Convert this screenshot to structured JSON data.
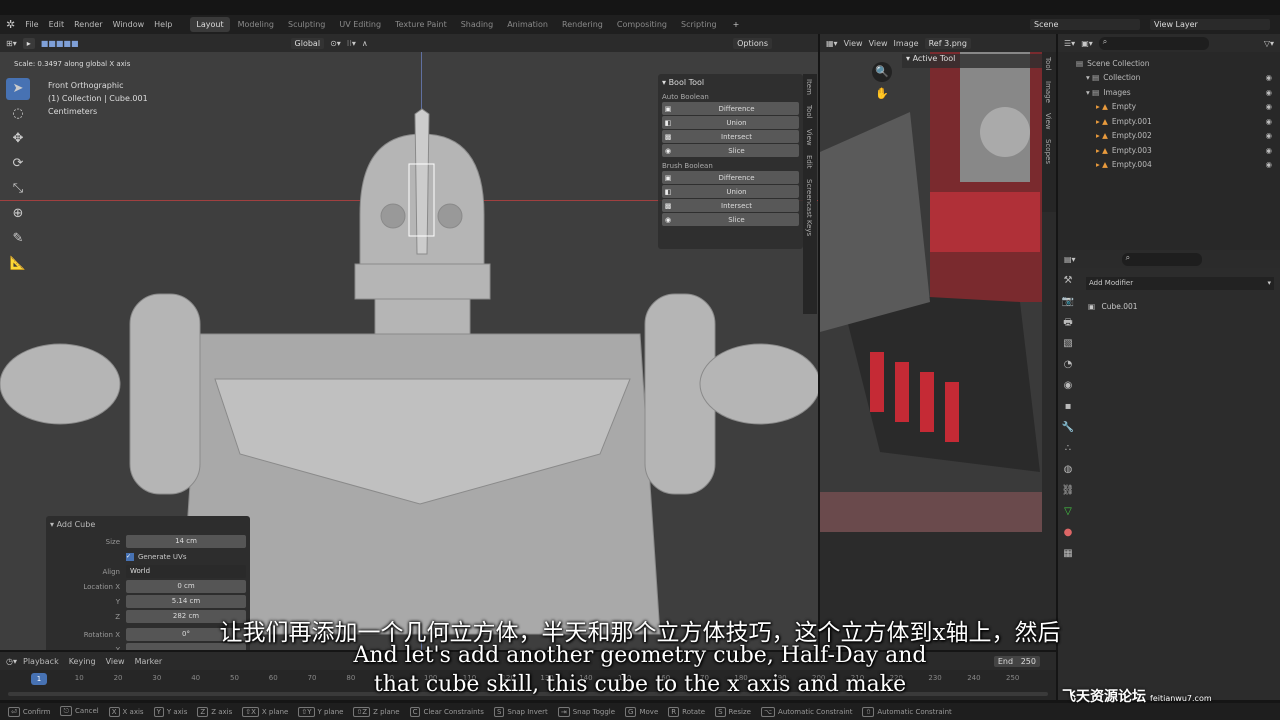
{
  "menubar": {
    "items": [
      "File",
      "Edit",
      "Render",
      "Window",
      "Help"
    ],
    "workspaces": [
      "Layout",
      "Modeling",
      "Sculpting",
      "UV Editing",
      "Texture Paint",
      "Shading",
      "Animation",
      "Rendering",
      "Compositing",
      "Scripting"
    ],
    "active_workspace": "Layout",
    "scene": "Scene",
    "view_layer": "View Layer"
  },
  "viewport": {
    "header": {
      "orientation": "Global",
      "options": "Options"
    },
    "operator_hint": "Scale: 0.3497 along global X axis",
    "info": [
      "Front Orthographic",
      "(1) Collection | Cube.001",
      "Centimeters"
    ],
    "bool_tool": {
      "title": "Bool Tool",
      "auto_label": "Auto Boolean",
      "auto": [
        "Difference",
        "Union",
        "Intersect",
        "Slice"
      ],
      "brush_label": "Brush Boolean",
      "brush": [
        "Difference",
        "Union",
        "Intersect",
        "Slice"
      ]
    },
    "side_tabs": [
      "Item",
      "Tool",
      "View",
      "Edit",
      "Screencast Keys"
    ],
    "add_cube": {
      "title": "Add Cube",
      "size_label": "Size",
      "size": "14 cm",
      "generate_uvs": "Generate UVs",
      "generate_uvs_checked": true,
      "align_label": "Align",
      "align": "World",
      "location_label": "Location X",
      "y_label": "Y",
      "z_label": "Z",
      "loc_x": "0 cm",
      "loc_y": "5.14 cm",
      "loc_z": "282 cm",
      "rotation_label": "Rotation X",
      "rot_x": "0°"
    }
  },
  "image_editor": {
    "view": "View",
    "view2": "View",
    "image": "Image",
    "file": "Ref 3.png",
    "active_tool": "Active Tool",
    "side_tabs": [
      "Tool",
      "Image",
      "View",
      "Scopes"
    ]
  },
  "outliner": {
    "scene_collection": "Scene Collection",
    "items": [
      {
        "name": "Collection",
        "level": 1
      },
      {
        "name": "Images",
        "level": 1
      },
      {
        "name": "Empty",
        "level": 2
      },
      {
        "name": "Empty.001",
        "level": 2
      },
      {
        "name": "Empty.002",
        "level": 2
      },
      {
        "name": "Empty.003",
        "level": 2
      },
      {
        "name": "Empty.004",
        "level": 2
      }
    ]
  },
  "properties": {
    "add_modifier": "Add Modifier",
    "object": "Cube.001"
  },
  "timeline": {
    "menus": [
      "Playback",
      "Keying",
      "View",
      "Marker"
    ],
    "current_frame": "1",
    "end_label": "End",
    "end": "250",
    "ticks": [
      "10",
      "20",
      "30",
      "40",
      "50",
      "60",
      "70",
      "80",
      "90",
      "100",
      "110",
      "120",
      "130",
      "140",
      "150",
      "160",
      "170",
      "180",
      "190",
      "200",
      "210",
      "220",
      "230",
      "240",
      "250"
    ]
  },
  "statusbar": [
    {
      "k": "⏎",
      "t": "Confirm"
    },
    {
      "k": "⎋",
      "t": "Cancel"
    },
    {
      "k": "X",
      "t": "X axis"
    },
    {
      "k": "Y",
      "t": "Y axis"
    },
    {
      "k": "Z",
      "t": "Z axis"
    },
    {
      "k": "⇧X",
      "t": "X plane"
    },
    {
      "k": "⇧Y",
      "t": "Y plane"
    },
    {
      "k": "⇧Z",
      "t": "Z plane"
    },
    {
      "k": "C",
      "t": "Clear Constraints"
    },
    {
      "k": "S",
      "t": "Snap Invert"
    },
    {
      "k": "⇥",
      "t": "Snap Toggle"
    },
    {
      "k": "G",
      "t": "Move"
    },
    {
      "k": "R",
      "t": "Rotate"
    },
    {
      "k": "S",
      "t": "Resize"
    },
    {
      "k": "⌥",
      "t": "Automatic Constraint"
    },
    {
      "k": "⇧",
      "t": "Automatic Constraint"
    }
  ],
  "subtitles": {
    "zh": "让我们再添加一个几何立方体，半天和那个立方体技巧，这个立方体到x轴上，然后",
    "en1": "And let's add another geometry cube, Half-Day and",
    "en2": "that cube skill, this cube to the x axis and make"
  },
  "watermark": "飞天资源论坛 feitianwu7.com",
  "colors": {
    "accent": "#4772b3",
    "x_axis": "#c04040",
    "background": "#3e3e3e"
  }
}
